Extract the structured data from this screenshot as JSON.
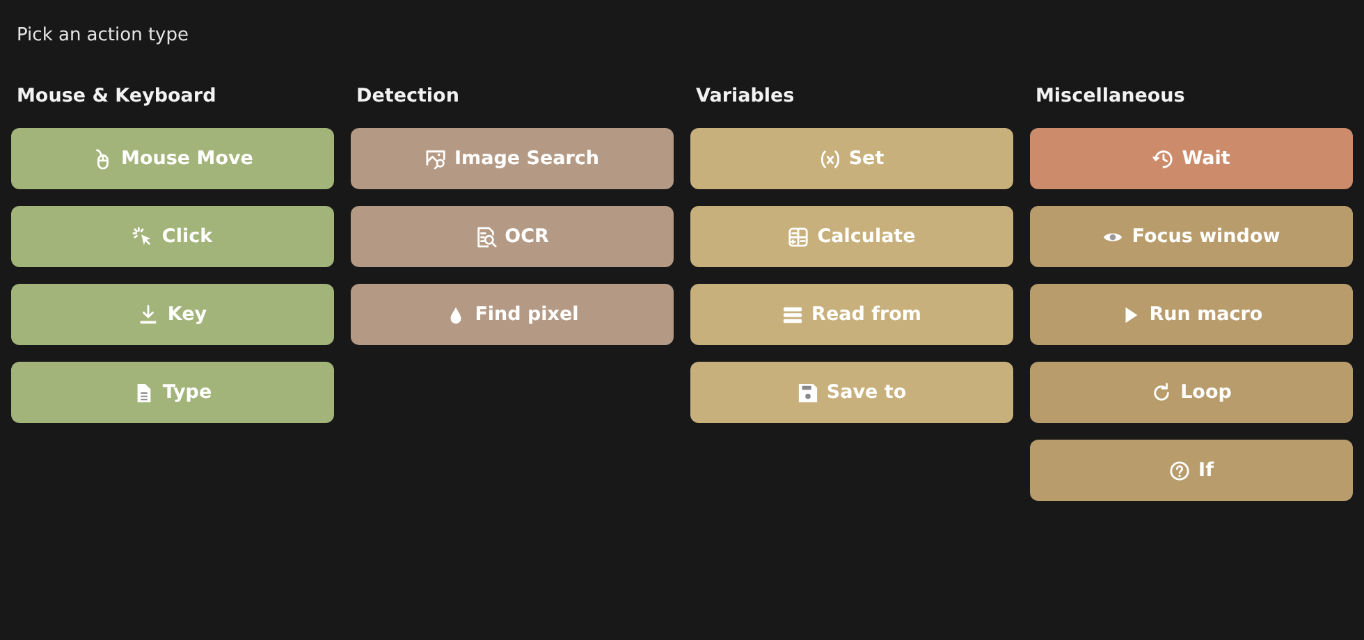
{
  "title": "Pick an action type",
  "groups": [
    {
      "heading": "Mouse & Keyboard",
      "actions": [
        {
          "label": "Mouse Move",
          "color": "#a3b47b"
        },
        {
          "label": "Click",
          "color": "#a3b47b"
        },
        {
          "label": "Key",
          "color": "#a3b47b"
        },
        {
          "label": "Type",
          "color": "#a3b47b"
        }
      ]
    },
    {
      "heading": "Detection",
      "actions": [
        {
          "label": "Image Search",
          "color": "#b49a85"
        },
        {
          "label": "OCR",
          "color": "#b49a85"
        },
        {
          "label": "Find pixel",
          "color": "#b49a85"
        }
      ]
    },
    {
      "heading": "Variables",
      "actions": [
        {
          "label": "Set",
          "color": "#c8b07c"
        },
        {
          "label": "Calculate",
          "color": "#c8b07c"
        },
        {
          "label": "Read from",
          "color": "#c8b07c"
        },
        {
          "label": "Save to",
          "color": "#c8b07c"
        }
      ]
    },
    {
      "heading": "Miscellaneous",
      "actions": [
        {
          "label": "Wait",
          "color": "#cc8b6a"
        },
        {
          "label": "Focus window",
          "color": "#b89c6c"
        },
        {
          "label": "Run macro",
          "color": "#b89c6c"
        },
        {
          "label": "Loop",
          "color": "#b89c6c"
        },
        {
          "label": "If",
          "color": "#b89c6c"
        }
      ]
    }
  ]
}
